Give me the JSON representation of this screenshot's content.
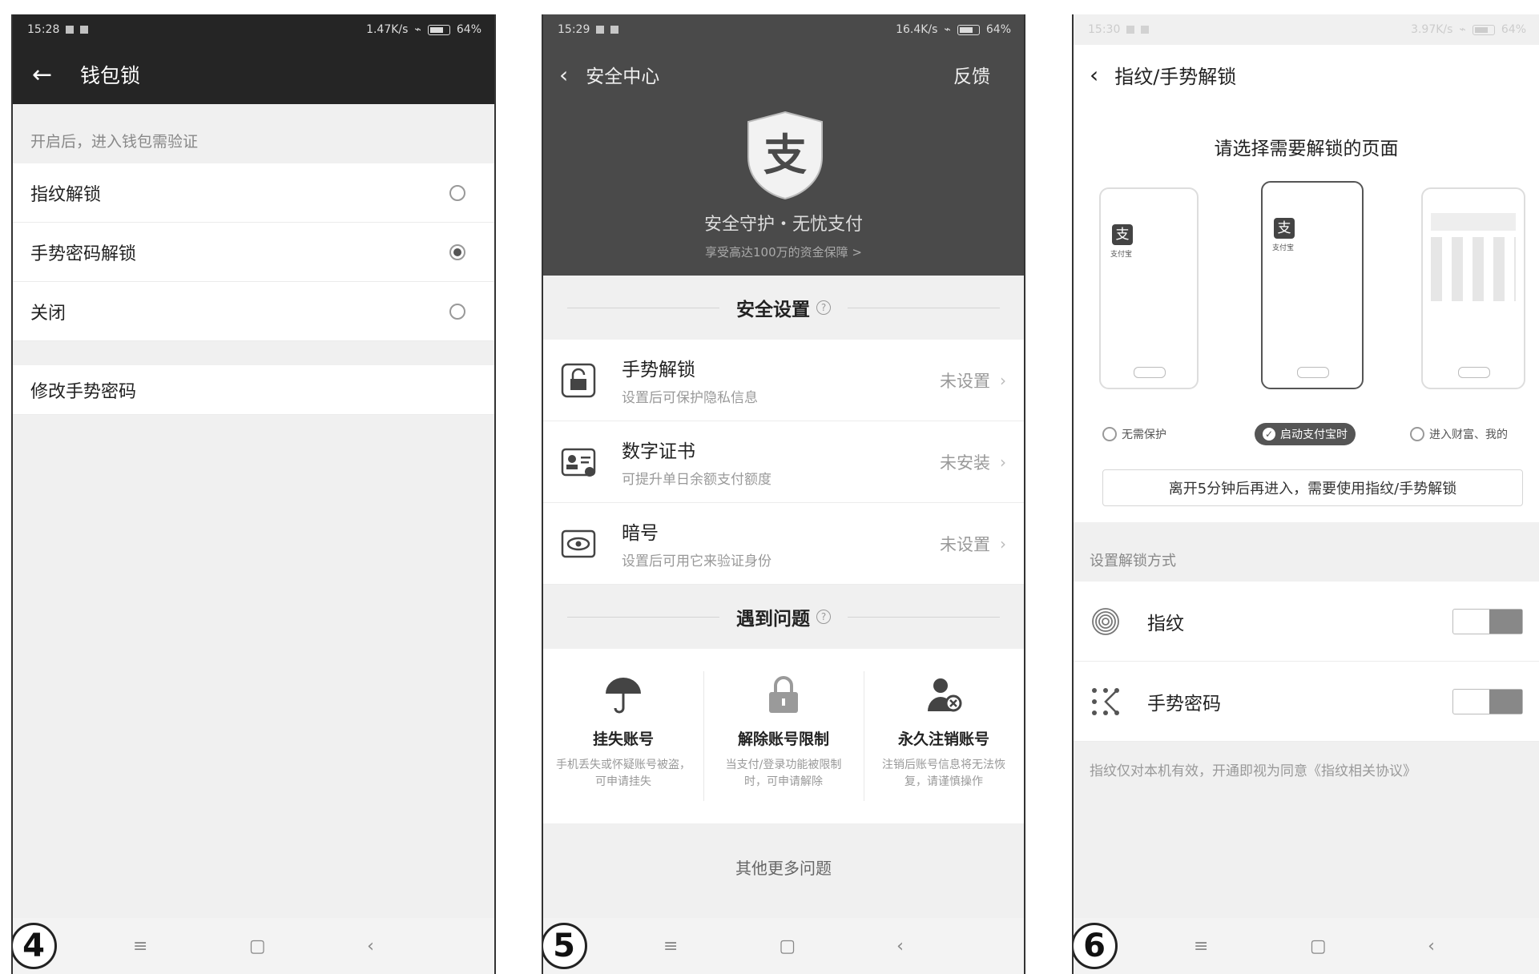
{
  "screen4": {
    "badge": "4",
    "status_time": "15:28",
    "status_right": "1.47K/s",
    "battery": "64%",
    "title": "钱包锁",
    "hint": "开启后，进入钱包需验证",
    "options": [
      {
        "label": "指纹解锁",
        "selected": false
      },
      {
        "label": "手势密码解锁",
        "selected": true
      },
      {
        "label": "关闭",
        "selected": false
      }
    ],
    "change_label": "修改手势密码"
  },
  "screen5": {
    "badge": "5",
    "status_time": "15:29",
    "status_right": "16.4K/s",
    "battery": "64%",
    "title": "安全中心",
    "feedback": "反馈",
    "logo_char": "支",
    "hero_title": "安全守护・无忧支付",
    "hero_sub": "享受高达100万的资金保障 >",
    "settings_header": "安全设置",
    "settings": [
      {
        "title": "手势解锁",
        "sub": "设置后可保护隐私信息",
        "value": "未设置",
        "icon": "lock-icon"
      },
      {
        "title": "数字证书",
        "sub": "可提升单日余额支付额度",
        "value": "未安装",
        "icon": "certificate-icon"
      },
      {
        "title": "暗号",
        "sub": "设置后可用它来验证身份",
        "value": "未设置",
        "icon": "eye-icon"
      }
    ],
    "problems_header": "遇到问题",
    "problems": [
      {
        "title": "挂失账号",
        "desc": "手机丢失或怀疑账号被盗，可申请挂失",
        "icon": "umbrella-icon"
      },
      {
        "title": "解除账号限制",
        "desc": "当支付/登录功能被限制时，可申请解除",
        "icon": "padlock-icon"
      },
      {
        "title": "永久注销账号",
        "desc": "注销后账号信息将无法恢复，请谨慎操作",
        "icon": "user-remove-icon"
      }
    ],
    "more": "其他更多问题"
  },
  "screen6": {
    "badge": "6",
    "status_time": "15:30",
    "status_right": "3.97K/s",
    "battery": "64%",
    "title": "指纹/手势解锁",
    "pick_title": "请选择需要解锁的页面",
    "app_label": "支付宝",
    "choices": [
      {
        "label": "无需保护",
        "selected": false
      },
      {
        "label": "启动支付宝时",
        "selected": true
      },
      {
        "label": "进入财富、我的",
        "selected": false
      }
    ],
    "notice": "离开5分钟后再进入，需要使用指纹/手势解锁",
    "section": "设置解锁方式",
    "methods": [
      {
        "label": "指纹",
        "icon": "fingerprint-icon"
      },
      {
        "label": "手势密码",
        "icon": "gesture-icon"
      }
    ],
    "footer": "指纹仅对本机有效，开通即视为同意《指纹相关协议》"
  },
  "navkeys": {
    "menu": "≡",
    "home": "▢",
    "back": "‹"
  }
}
